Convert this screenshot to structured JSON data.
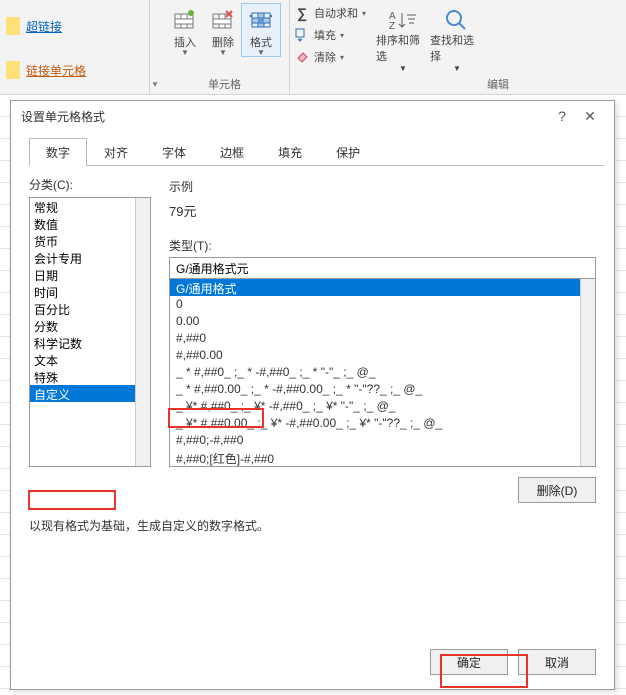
{
  "ribbon": {
    "style1": "超链接",
    "style2": "链接单元格",
    "insert": "插入",
    "delete": "删除",
    "format": "格式",
    "cells_group": "单元格",
    "autosum": "自动求和",
    "fill": "填充",
    "clear": "清除",
    "sort_filter": "排序和筛选",
    "find_select": "查找和选择",
    "edit_group": "编辑"
  },
  "dialog": {
    "title": "设置单元格格式",
    "tabs": [
      "数字",
      "对齐",
      "字体",
      "边框",
      "填充",
      "保护"
    ],
    "active_tab": 0,
    "category_label": "分类(C):",
    "categories": [
      "常规",
      "数值",
      "货币",
      "会计专用",
      "日期",
      "时间",
      "百分比",
      "分数",
      "科学记数",
      "文本",
      "特殊",
      "自定义"
    ],
    "selected_category": 11,
    "sample_label": "示例",
    "sample_value": "79元",
    "type_label": "类型(T):",
    "type_value": "G/通用格式元",
    "type_list": [
      "G/通用格式",
      "0",
      "0.00",
      "#,##0",
      "#,##0.00",
      "_ * #,##0_ ;_ * -#,##0_ ;_ * \"-\"_ ;_ @_ ",
      "_ * #,##0.00_ ;_ * -#,##0.00_ ;_ * \"-\"??_ ;_ @_ ",
      "_ ¥* #,##0_ ;_ ¥* -#,##0_ ;_ ¥* \"-\"_ ;_ @_ ",
      "_ ¥* #,##0.00_ ;_ ¥* -#,##0.00_ ;_ ¥* \"-\"??_ ;_ @_ ",
      "#,##0;-#,##0",
      "#,##0;[红色]-#,##0"
    ],
    "type_selected": 0,
    "delete": "删除(D)",
    "hint": "以现有格式为基础，生成自定义的数字格式。",
    "ok": "确定",
    "cancel": "取消"
  }
}
